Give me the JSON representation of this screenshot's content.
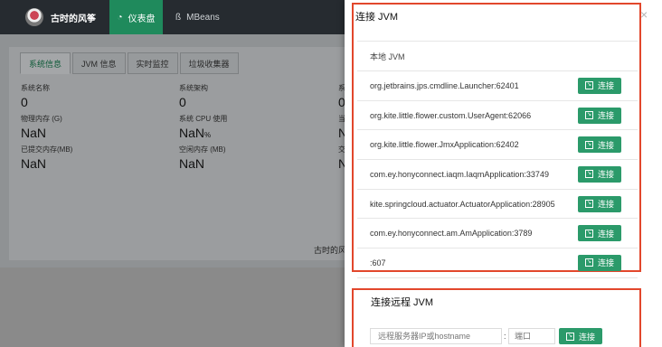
{
  "topbar": {
    "user_name": "古时的风筝",
    "nav": [
      {
        "label": "仪表盘",
        "icon": "dashboard-icon"
      },
      {
        "label": "MBeans",
        "icon": "beans-icon"
      }
    ]
  },
  "main": {
    "tabs": [
      "系统信息",
      "JVM 信息",
      "实时监控",
      "垃圾收集器"
    ],
    "fields": [
      {
        "label": "系统名称",
        "value": "0",
        "unit": ""
      },
      {
        "label": "系统架构",
        "value": "0",
        "unit": ""
      },
      {
        "label": "物理内存 (G)",
        "value": "NaN",
        "unit": ""
      },
      {
        "label": "系统 CPU 使用",
        "value": "NaN",
        "unit": "%"
      },
      {
        "label": "已提交内存(MB)",
        "value": "NaN",
        "unit": ""
      },
      {
        "label": "空闲内存 (MB)",
        "value": "NaN",
        "unit": ""
      }
    ],
    "partial_labels": [
      "系",
      "当",
      "交"
    ],
    "partial_values": [
      "0",
      "N",
      "N"
    ],
    "footer_partial": "古时的风"
  },
  "panel": {
    "title": "连接 JVM",
    "close": "×",
    "local_header": "本地 JVM",
    "connect_label": "连接",
    "local_jvms": [
      "org.jetbrains.jps.cmdline.Launcher:62401",
      "org.kite.little.flower.custom.UserAgent:62066",
      "org.kite.little.flower.JmxApplication:62402",
      "com.ey.honyconnect.iaqm.IaqmApplication:33749",
      "kite.springcloud.actuator.ActuatorApplication:28905",
      "com.ey.honyconnect.am.AmApplication:3789",
      ":607"
    ],
    "remote": {
      "title": "连接远程 JVM",
      "host_placeholder": "远程服务器IP或hostname",
      "separator": ":",
      "port_placeholder": "端口",
      "connect_label": "连接"
    }
  }
}
